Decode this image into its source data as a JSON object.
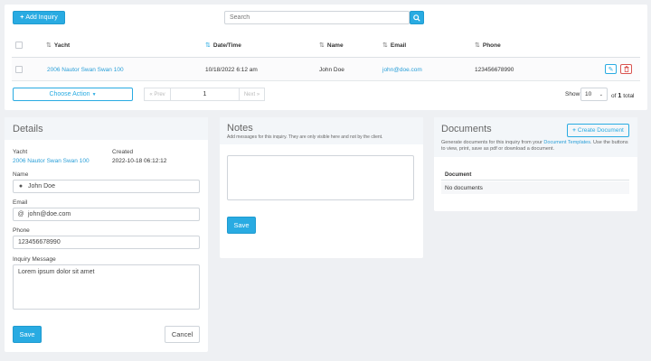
{
  "toolbar": {
    "add_inquiry_label": "Add Inquiry",
    "search_placeholder": "Search"
  },
  "table": {
    "headers": {
      "yacht": "Yacht",
      "datetime": "Date/Time",
      "name": "Name",
      "email": "Email",
      "phone": "Phone"
    },
    "rows": [
      {
        "yacht": "2006 Nautor Swan Swan 100",
        "datetime": "10/18/2022 6:12 am",
        "name": "John Doe",
        "email": "john@doe.com",
        "phone": "123456678990"
      }
    ]
  },
  "pagination": {
    "choose_action_label": "Choose Action",
    "prev_label": "« Prev",
    "current_page": "1",
    "next_label": "Next »",
    "show_label": "Show",
    "page_size": "10",
    "of_label": "of",
    "total_count": "1",
    "total_label": "total"
  },
  "details": {
    "title": "Details",
    "yacht_label": "Yacht",
    "yacht_value": "2006 Nautor Swan Swan 100",
    "created_label": "Created",
    "created_value": "2022-10-18 06:12:12",
    "name_label": "Name",
    "name_value": "John Doe",
    "email_label": "Email",
    "email_value": "john@doe.com",
    "phone_label": "Phone",
    "phone_value": "123456678990",
    "message_label": "Inquiry Message",
    "message_value": "Lorem ipsum dolor sit amet",
    "save_label": "Save",
    "cancel_label": "Cancel"
  },
  "notes": {
    "title": "Notes",
    "subtitle": "Add messages for this inquiry. They are only visible here and not by the client.",
    "save_label": "Save"
  },
  "documents": {
    "title": "Documents",
    "create_label": "Create Document",
    "desc_prefix": "Generate documents for this inquiry from your",
    "desc_link": "Document Templates",
    "desc_suffix": ". Use the buttons to view, print, save as pdf or download a document.",
    "column_header": "Document",
    "empty_text": "No documents"
  },
  "colors": {
    "accent": "#29abe2",
    "danger": "#d9534f",
    "background": "#eef0f3"
  }
}
